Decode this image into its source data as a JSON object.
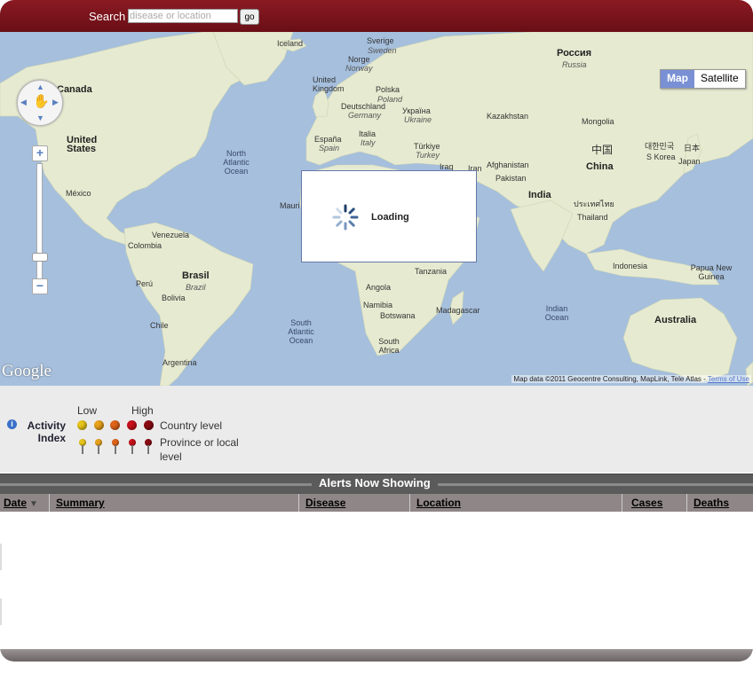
{
  "header": {
    "search_label": "Search",
    "search_placeholder": "disease or location",
    "go_label": "go"
  },
  "map": {
    "map_type_buttons": [
      "Map",
      "Satellite"
    ],
    "selected_map_type": "Map",
    "loading_text": "Loading",
    "google_logo": "Google",
    "attribution": "Map data ©2011 Geocentre Consulting, MapLink, Tele Atlas - ",
    "terms_link": "Terms of Use",
    "labels": {
      "iceland": "Iceland",
      "sverige": "Sverige",
      "sweden": "Sweden",
      "norge": "Norge",
      "norway": "Norway",
      "rossiya": "Россия",
      "russia": "Russia",
      "canada": "Canada",
      "united_kingdom": "United Kingdom",
      "polska": "Polska",
      "poland": "Poland",
      "ukraina": "Україна",
      "ukraine": "Ukraine",
      "deutschland": "Deutschland",
      "germany": "Germany",
      "kazakhstan": "Kazakhstan",
      "mongolia": "Mongolia",
      "united_states": "United States",
      "espana": "España",
      "spain": "Spain",
      "italia": "Italia",
      "italy": "Italy",
      "turkiye": "Türkiye",
      "turkey": "Turkey",
      "china_native": "中国",
      "china": "China",
      "korea_native": "대한민국",
      "s_korea": "S Korea",
      "japan_native": "日本",
      "japan": "Japan",
      "north_atlantic_ocean": "North Atlantic Ocean",
      "iraq": "Iraq",
      "iran": "Iran",
      "afghanistan": "Afghanistan",
      "pakistan": "Pakistan",
      "mexico": "México",
      "mauri": "Mauri",
      "india": "India",
      "thai_native": "ประเทศไทย",
      "thailand": "Thailand",
      "venezuela": "Venezuela",
      "colombia": "Colombia",
      "tanzania": "Tanzania",
      "brasil": "Brasil",
      "brazil": "Brazil",
      "peru": "Perú",
      "angola": "Angola",
      "indonesia": "Indonesia",
      "papua_new_guinea": "Papua New Guinea",
      "bolivia": "Bolivia",
      "namibia": "Namibia",
      "botswana": "Botswana",
      "madagascar": "Madagascar",
      "indian_ocean": "Indian Ocean",
      "chile": "Chile",
      "south_atlantic_ocean": "South Atlantic Ocean",
      "south_africa": "South Africa",
      "australia": "Australia",
      "argentina": "Argentina"
    }
  },
  "legend": {
    "title": "Activity Index",
    "low": "Low",
    "high": "High",
    "country_level": "Country level",
    "province_level": "Province or local level",
    "colors": [
      "#e8c51a",
      "#e8a11a",
      "#e0641a",
      "#c8101a",
      "#8a0a12"
    ]
  },
  "alerts": {
    "title": "Alerts Now Showing",
    "columns": [
      "Date",
      "Summary",
      "Disease",
      "Location",
      "Cases",
      "Deaths"
    ],
    "rows": []
  },
  "colors": {
    "header": "#6e0f18",
    "table_header": "#8f8787",
    "map_water": "#a5bfdd",
    "map_land": "#e8ebd0"
  }
}
